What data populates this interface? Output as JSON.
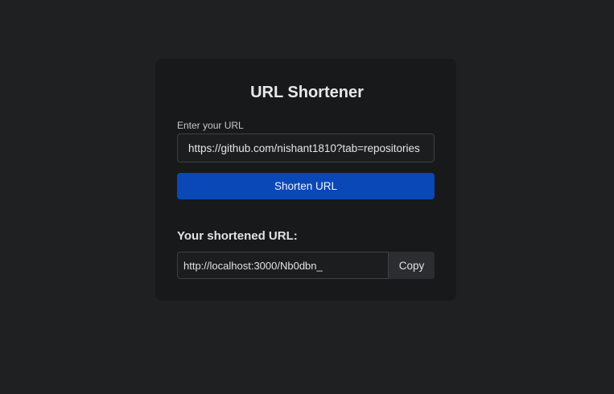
{
  "app": {
    "title": "URL Shortener"
  },
  "form": {
    "label": "Enter your URL",
    "url_value": "https://github.com/nishant1810?tab=repositories",
    "submit_label": "Shorten URL"
  },
  "result": {
    "heading": "Your shortened URL:",
    "short_url": "http://localhost:3000/Nb0dbn_",
    "copy_label": "Copy"
  },
  "colors": {
    "background": "#1f2022",
    "card": "#18191a",
    "primary_button": "#0a47b7",
    "copy_button": "#2b2d30"
  }
}
